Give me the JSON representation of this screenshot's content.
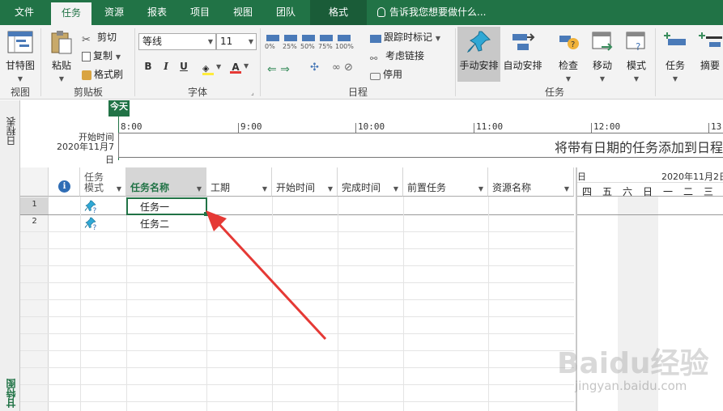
{
  "tabs": [
    "文件",
    "任务",
    "资源",
    "报表",
    "项目",
    "视图",
    "团队",
    "格式"
  ],
  "active_tab": "任务",
  "tell_me": "告诉我您想要做什么...",
  "ribbon": {
    "view_group": {
      "label": "视图",
      "gantt_button": "甘特图"
    },
    "clipboard_group": {
      "label": "剪贴板",
      "paste": "粘贴",
      "cut": "剪切",
      "copy": "复制",
      "format_painter": "格式刷"
    },
    "font_group": {
      "label": "字体",
      "font_name": "等线",
      "font_size": "11",
      "bold": "B",
      "italic": "I",
      "underline": "U"
    },
    "schedule_group": {
      "label": "日程",
      "percents": [
        "0%",
        "25%",
        "50%",
        "75%",
        "100%"
      ],
      "track": "跟踪时标记",
      "respect_links": "考虑链接",
      "inactivate": "停用"
    },
    "tasks_group": {
      "label": "任务",
      "manual": "手动安排",
      "auto": "自动安排",
      "inspect": "检查",
      "move": "移动",
      "mode": "模式"
    },
    "insert_group": {
      "task": "任务",
      "summary": "摘要"
    }
  },
  "timeline": {
    "side_label": "日程表",
    "today": "今天",
    "start_label": "开始时间",
    "start_date": "2020年11月7日",
    "ticks": [
      "8:00",
      "9:00",
      "10:00",
      "11:00",
      "12:00",
      "13"
    ],
    "placeholder": "将带有日期的任务添加到日程"
  },
  "table": {
    "headers": {
      "info": "i",
      "mode": "任务\n模式",
      "name": "任务名称",
      "duration": "工期",
      "start": "开始时间",
      "finish": "完成时间",
      "predecessors": "前置任务",
      "resources": "资源名称"
    },
    "rows": [
      {
        "num": "1",
        "name": "任务一"
      },
      {
        "num": "2",
        "name": "任务二"
      }
    ]
  },
  "gantt": {
    "top_left": "日",
    "top_right": "2020年11月2日",
    "days": [
      "四",
      "五",
      "六",
      "日",
      "一",
      "二",
      "三"
    ]
  },
  "view_label": "甘特图",
  "watermark": {
    "text": "Baidu经验",
    "url": "jingyan.baidu.com"
  },
  "colors": {
    "brand": "#217346",
    "arrow": "#e53935",
    "manual_active": "#c8c8c8"
  }
}
